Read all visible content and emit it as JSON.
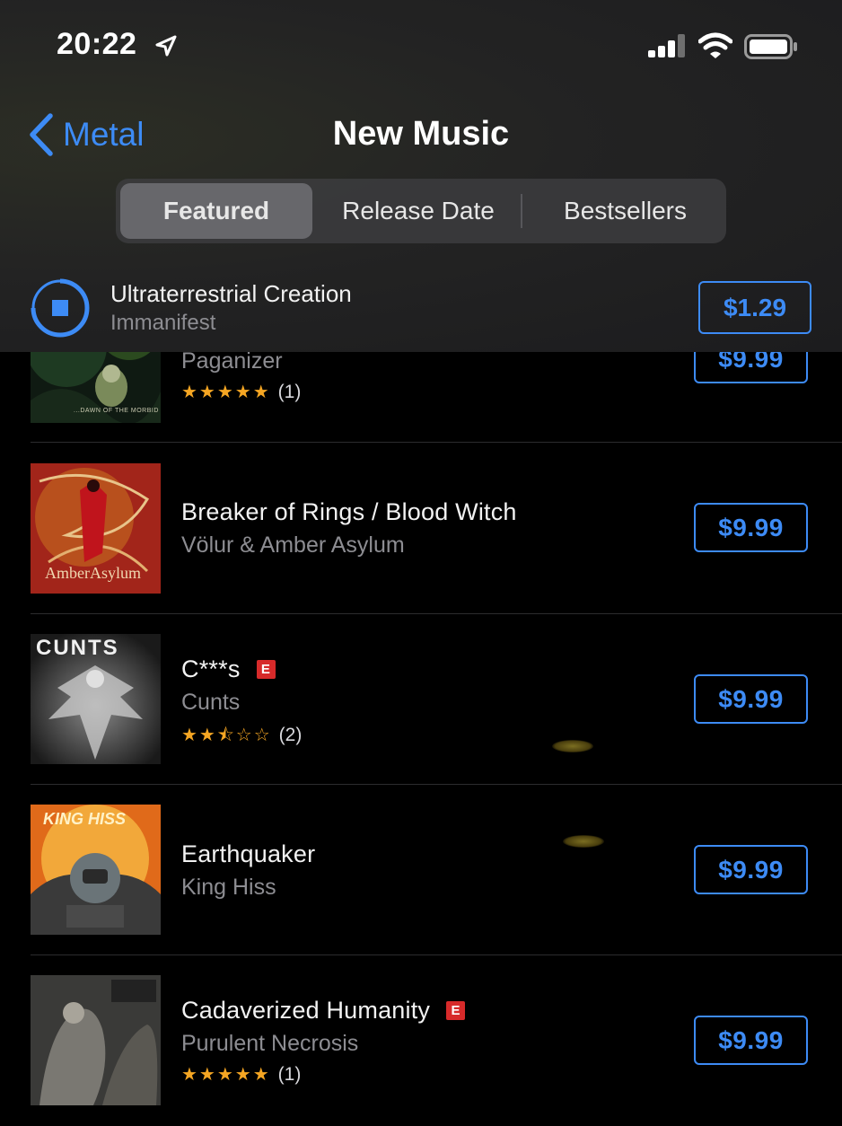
{
  "status_bar": {
    "time": "20:22"
  },
  "nav": {
    "back_label": "Metal",
    "title": "New Music"
  },
  "segments": [
    "Featured",
    "Release Date",
    "Bestsellers"
  ],
  "now_playing": {
    "title": "Ultraterrestrial Creation",
    "artist": "Immanifest",
    "price": "$1.29"
  },
  "albums": [
    {
      "title": "",
      "artist": "Paganizer",
      "stars": "★★★★★",
      "rating_count": "(1)",
      "price": "$9.99",
      "art_caption": "...DAWN OF THE MORBID"
    },
    {
      "title": "Breaker of Rings / Blood Witch",
      "artist": "Völur & Amber Asylum",
      "price": "$9.99",
      "art_caption": "AmberAsylum"
    },
    {
      "title": "C***s",
      "explicit": "E",
      "artist": "Cunts",
      "stars": "★★⯪☆☆",
      "rating_count": "(2)",
      "price": "$9.99",
      "art_caption": "CUNTS"
    },
    {
      "title": "Earthquaker",
      "artist": "King Hiss",
      "price": "$9.99",
      "art_caption": "KING HISS"
    },
    {
      "title": "Cadaverized Humanity",
      "explicit": "E",
      "artist": "Purulent Necrosis",
      "stars": "★★★★★",
      "rating_count": "(1)",
      "price": "$9.99"
    }
  ],
  "colors": {
    "accent": "#3d8bf5",
    "star": "#f5a623",
    "explicit": "#d72a2a"
  }
}
